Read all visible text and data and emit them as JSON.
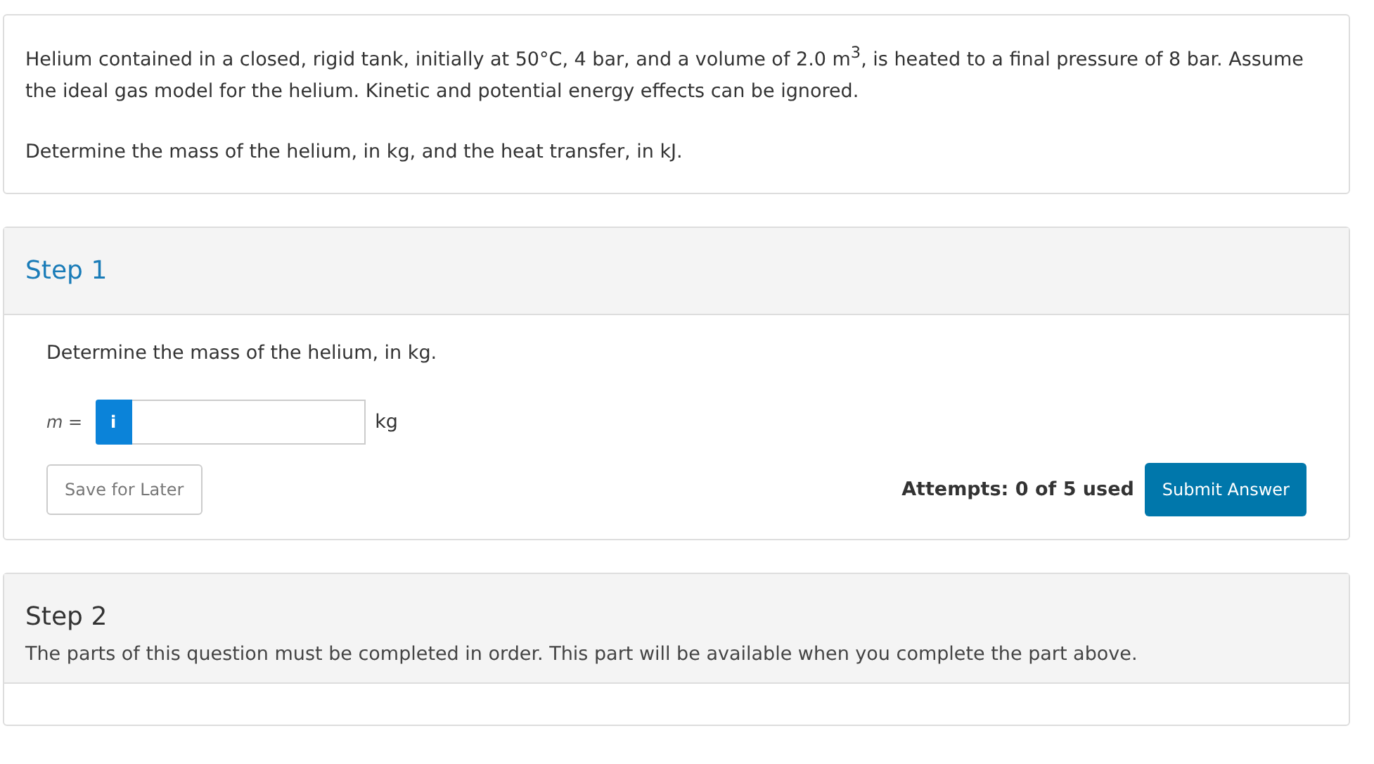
{
  "problem": {
    "paragraphs": [
      "Helium contained in a closed, rigid tank, initially at 50°C, 4 bar, and a volume of 2.0 m$^{3}$, is heated to a final pressure of 8 bar. Assume the ideal gas model for the helium.  Kinetic and potential energy effects can be ignored.",
      "Determine the mass of the helium, in kg, and the heat transfer, in kJ."
    ]
  },
  "steps": [
    {
      "title": "Step 1",
      "active": true,
      "prompt": "Determine the mass of the helium, in kg.",
      "answer": {
        "variable": "m",
        "equals": "=",
        "info": "i",
        "unit": "kg"
      },
      "save_button": "Save for Later",
      "attempts": "Attempts: 0 of 5 used",
      "submit_button": "Submit Answer"
    },
    {
      "title": "Step 2",
      "active": false,
      "notice": "The parts of this question must be completed in order. This part will be available when you complete the part above."
    }
  ]
}
